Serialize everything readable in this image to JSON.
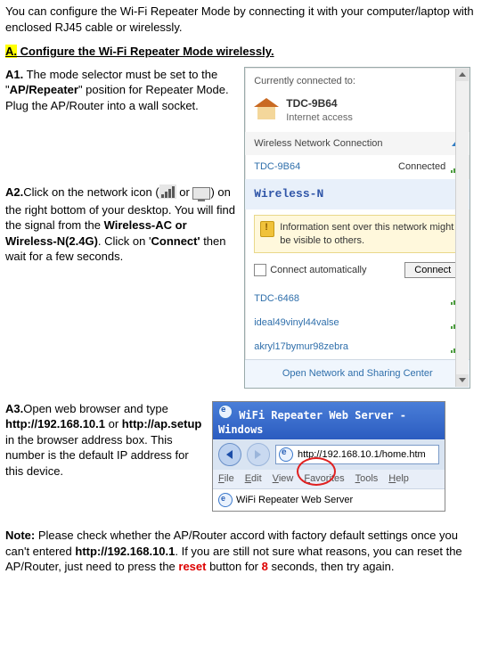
{
  "intro": "You can configure the Wi-Fi Repeater Mode by connecting it with your computer/laptop with enclosed RJ45 cable or wirelessly.",
  "heading": {
    "prefix": "A.",
    "rest": " Configure the Wi-Fi Repeater Mode wirelessly."
  },
  "a1": {
    "label": "A1.",
    "t1": " The mode selector must be set to the \"",
    "bold1": "AP/Repeater",
    "t2": "\" position for Repeater Mode. Plug the AP/Router into a wall socket."
  },
  "a2": {
    "label": "A2.",
    "t1": "Click on the network icon (",
    "t_or": " or ",
    "t2": ") on the right bottom of your desktop. You will find the signal from the ",
    "bold1": "Wireless-AC or Wireless-N(2.4G)",
    "t3": ". Click on '",
    "bold2": "Connect'",
    "t4": " then wait for a few seconds."
  },
  "a3": {
    "label": "A3.",
    "t1": "Open web browser and type ",
    "bold1": "http://192.168.10.1",
    "t2": " or ",
    "bold2": "http://ap.setup",
    "t3": " in the browser address box. This number is the default IP address for this device."
  },
  "note": {
    "label": "Note:",
    "t1": "  Please check whether the AP/Router accord with factory default settings once you can't entered ",
    "bold1": "http://192.168.10.1",
    "t2": ". If you are still not sure what reasons, you can reset the AP/Router, just need to press the ",
    "red1": "reset",
    "t3": " button for ",
    "red2": "8",
    "t4": " seconds, then try again."
  },
  "wifi": {
    "header": "Currently connected to:",
    "current": {
      "name": "TDC-9B64",
      "sub": "Internet access"
    },
    "section": "Wireless Network Connection",
    "connected_net": "TDC-9B64",
    "connected_status": "Connected",
    "selected": "Wireless-N",
    "info": "Information sent over this network might be visible to others.",
    "auto": "Connect automatically",
    "connect_btn": "Connect",
    "list": [
      "TDC-6468",
      "ideal49vinyl44valse",
      "akryl17bymur98zebra"
    ],
    "footer": "Open Network and Sharing Center"
  },
  "browser": {
    "title": "WiFi Repeater Web Server - Windows",
    "url": "http://192.168.10.1/home.htm",
    "menu": [
      "File",
      "Edit",
      "View",
      "Favorites",
      "Tools",
      "Help"
    ],
    "tab": "WiFi Repeater Web Server"
  }
}
